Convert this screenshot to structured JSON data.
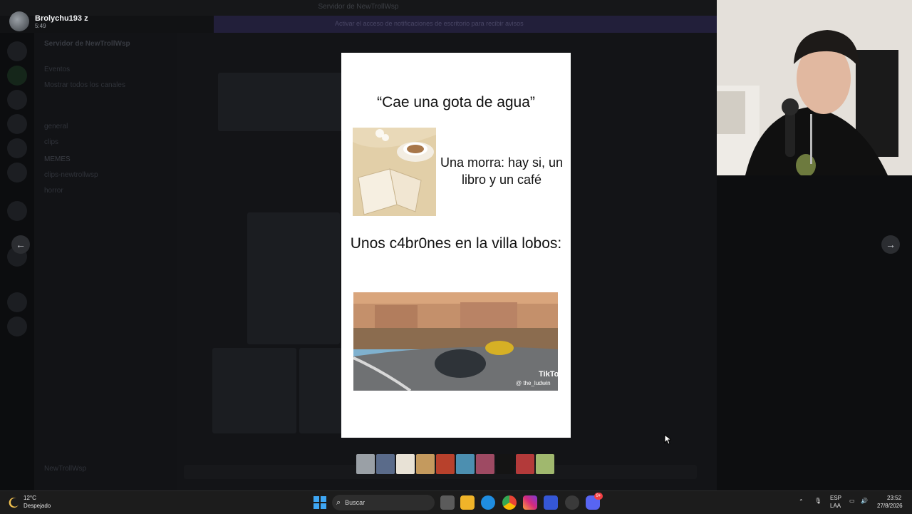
{
  "background_app": {
    "window_title": "Servidor de NewTrollWsp",
    "banner_text": "Activar el acceso de notificaciones de escritorio para recibir avisos",
    "server_name": "Servidor de NewTrollWsp",
    "channels": [
      "Eventos",
      "Mostrar todos los canales",
      "general",
      "clips",
      "MEMES",
      "clips-newtrollwsp",
      "horror"
    ],
    "current_user": "NewTrollWsp"
  },
  "viewer": {
    "author_name": "Brolychu193 z",
    "author_time": "5:49",
    "meme_caption_top": "“Cae una gota de agua”",
    "meme_side_text": "Una morra: hay si, un libro y un café",
    "meme_caption_bottom": "Unos c4br0nes en la villa lobos:",
    "watermark_brand": "TikTok",
    "watermark_handle": "@ the_ludwin",
    "prev_icon": "←",
    "next_icon": "→"
  },
  "taskbar": {
    "weather_temp": "12°C",
    "weather_desc": "Despejado",
    "search_placeholder": "Buscar",
    "lang_top": "ESP",
    "lang_bottom": "LAA",
    "time": "23:52",
    "date": "27/8/2026",
    "discord_badge": "9+"
  },
  "colors": {
    "accent_blurple": "#5865f2",
    "viewer_bg": "#ffffff",
    "taskbar_bg": "#1c1c1c"
  }
}
